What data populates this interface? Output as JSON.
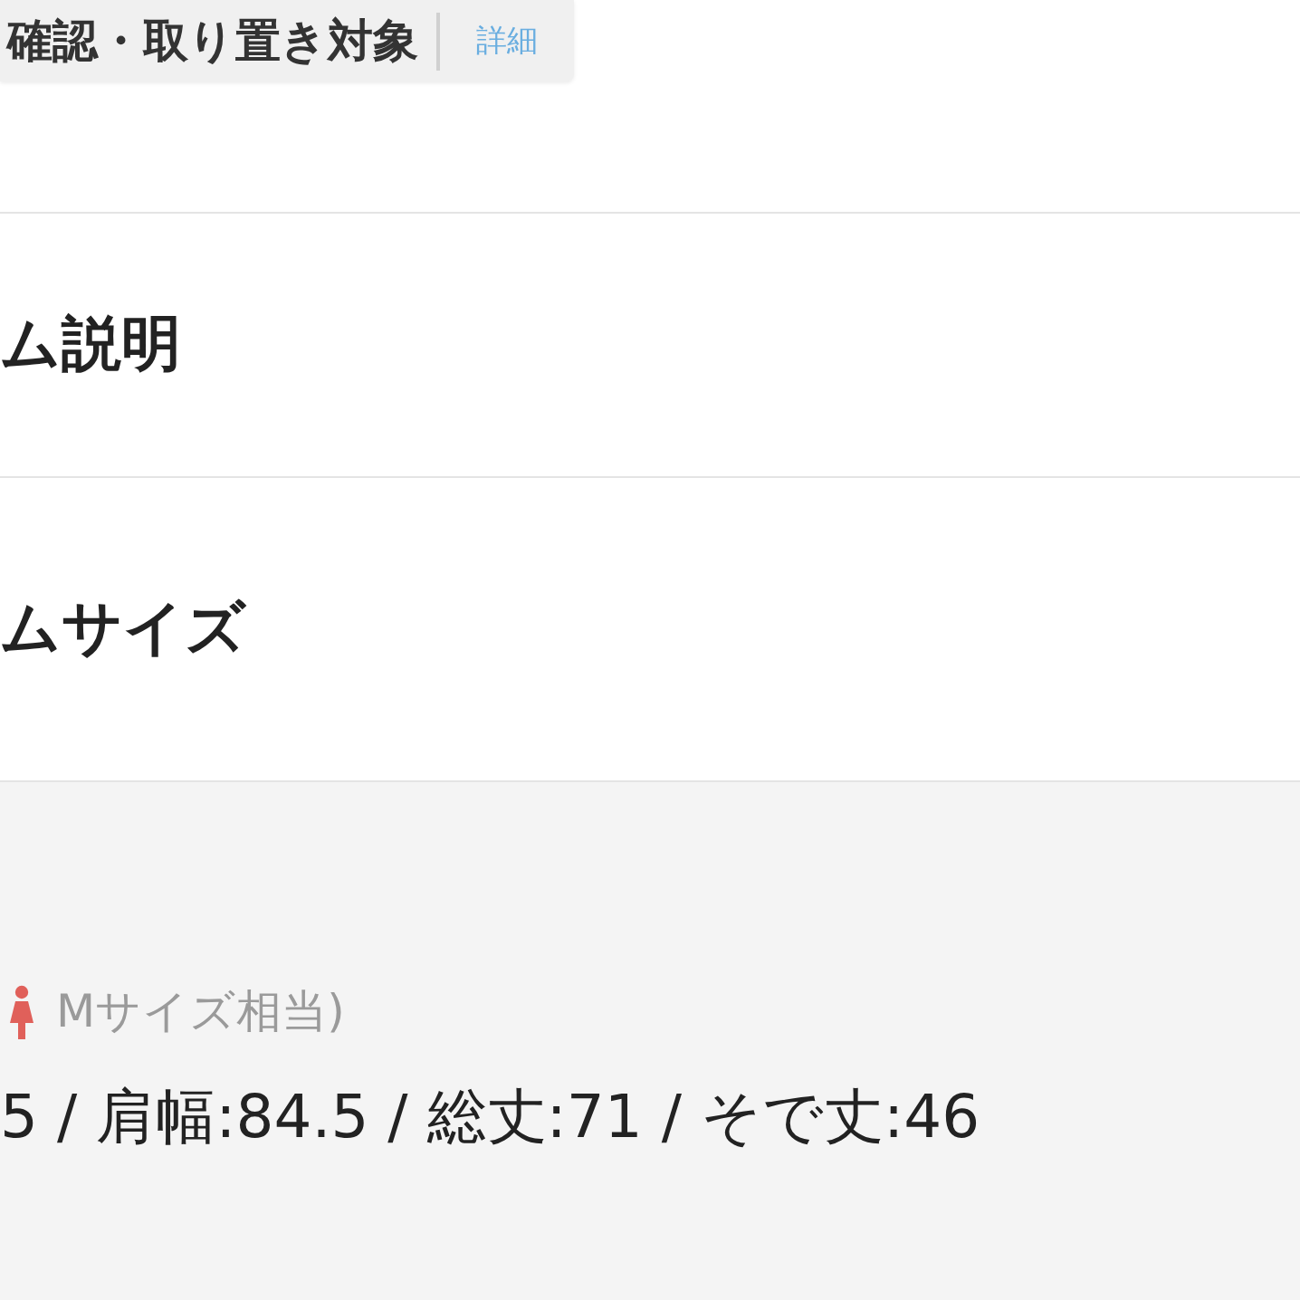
{
  "badge": {
    "text": "確認・取り置き対象",
    "link": "詳細"
  },
  "sections": [
    {
      "title": "ム説明"
    },
    {
      "title": "ムサイズ"
    }
  ],
  "size_panel": {
    "note": "Mサイズ相当)",
    "measurements": "5 / 肩幅:84.5 / 総丈:71 / そで丈:46"
  }
}
